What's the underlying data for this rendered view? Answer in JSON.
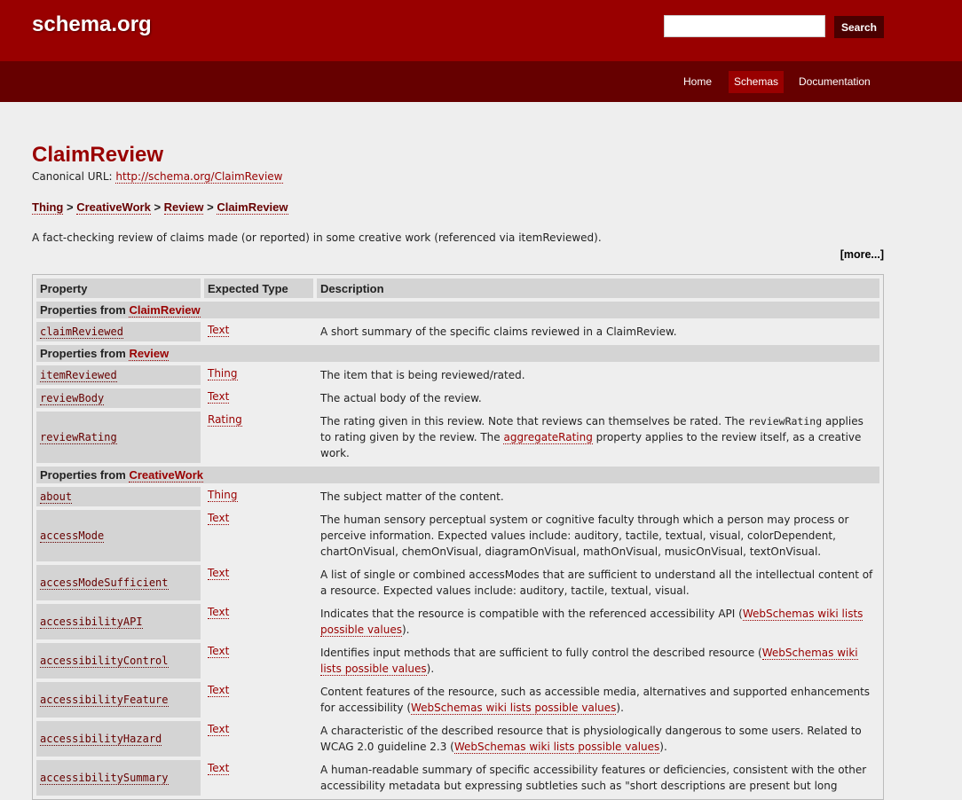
{
  "header": {
    "logo": "schema.org",
    "search": {
      "value": "",
      "placeholder": "",
      "button_label": "Search"
    },
    "nav": [
      {
        "label": "Home",
        "active": false
      },
      {
        "label": "Schemas",
        "active": true
      },
      {
        "label": "Documentation",
        "active": false
      }
    ]
  },
  "page": {
    "title": "ClaimReview",
    "canonical_label": "Canonical URL:",
    "canonical_url": "http://schema.org/ClaimReview",
    "breadcrumb": [
      "Thing",
      "CreativeWork",
      "Review",
      "ClaimReview"
    ],
    "breadcrumb_sep": ">",
    "summary": "A fact-checking review of claims made (or reported) in some creative work (referenced via itemReviewed).",
    "more": "[more...]"
  },
  "table": {
    "headers": [
      "Property",
      "Expected Type",
      "Description"
    ],
    "from_label": "Properties from",
    "groups": [
      {
        "from": "ClaimReview",
        "rows": [
          {
            "prop": "claimReviewed",
            "type": "Text",
            "desc": [
              {
                "t": "A short summary of the specific claims reviewed in a ClaimReview."
              }
            ]
          }
        ]
      },
      {
        "from": "Review",
        "rows": [
          {
            "prop": "itemReviewed",
            "type": "Thing",
            "desc": [
              {
                "t": "The item that is being reviewed/rated."
              }
            ]
          },
          {
            "prop": "reviewBody",
            "type": "Text",
            "desc": [
              {
                "t": "The actual body of the review."
              }
            ]
          },
          {
            "prop": "reviewRating",
            "type": "Rating",
            "desc": [
              {
                "t": "The rating given in this review. Note that reviews can themselves be rated. The "
              },
              {
                "code": "reviewRating"
              },
              {
                "t": " applies to rating given by the review. The "
              },
              {
                "link": "aggregateRating"
              },
              {
                "t": " property applies to the review itself, as a creative work."
              }
            ]
          }
        ]
      },
      {
        "from": "CreativeWork",
        "rows": [
          {
            "prop": "about",
            "type": "Thing",
            "desc": [
              {
                "t": "The subject matter of the content."
              }
            ]
          },
          {
            "prop": "accessMode",
            "type": "Text",
            "desc": [
              {
                "t": "The human sensory perceptual system or cognitive faculty through which a person may process or perceive information. Expected values include: auditory, tactile, textual, visual, colorDependent, chartOnVisual, chemOnVisual, diagramOnVisual, mathOnVisual, musicOnVisual, textOnVisual."
              }
            ]
          },
          {
            "prop": "accessModeSufficient",
            "type": "Text",
            "desc": [
              {
                "t": "A list of single or combined accessModes that are sufficient to understand all the intellectual content of a resource. Expected values include: auditory, tactile, textual, visual."
              }
            ]
          },
          {
            "prop": "accessibilityAPI",
            "type": "Text",
            "desc": [
              {
                "t": "Indicates that the resource is compatible with the referenced accessibility API ("
              },
              {
                "link": "WebSchemas wiki lists possible values"
              },
              {
                "t": ")."
              }
            ]
          },
          {
            "prop": "accessibilityControl",
            "type": "Text",
            "desc": [
              {
                "t": "Identifies input methods that are sufficient to fully control the described resource ("
              },
              {
                "link": "WebSchemas wiki lists possible values"
              },
              {
                "t": ")."
              }
            ]
          },
          {
            "prop": "accessibilityFeature",
            "type": "Text",
            "desc": [
              {
                "t": "Content features of the resource, such as accessible media, alternatives and supported enhancements for accessibility ("
              },
              {
                "link": "WebSchemas wiki lists possible values"
              },
              {
                "t": ")."
              }
            ]
          },
          {
            "prop": "accessibilityHazard",
            "type": "Text",
            "desc": [
              {
                "t": "A characteristic of the described resource that is physiologically dangerous to some users. Related to WCAG 2.0 guideline 2.3 ("
              },
              {
                "link": "WebSchemas wiki lists possible values"
              },
              {
                "t": ")."
              }
            ]
          },
          {
            "prop": "accessibilitySummary",
            "type": "Text",
            "desc": [
              {
                "t": "A human-readable summary of specific accessibility features or deficiencies, consistent with the other accessibility metadata but expressing subtleties such as \"short descriptions are present but long"
              }
            ]
          }
        ]
      }
    ]
  }
}
